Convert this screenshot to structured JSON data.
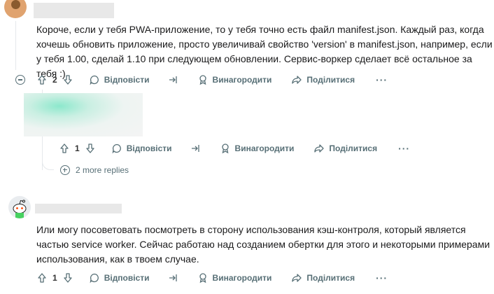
{
  "comments": [
    {
      "text": "Короче, если у тебя PWA-приложение, то у тебя точно есть файл manifest.json. Каждый раз, когда хочешь обновить приложение, просто увеличивай свойство 'version' в manifest.json, например, если у тебя 1.00, сделай 1.10 при следующем обновлении. Сервис-воркер сделает всё остальное за тебя :)",
      "votes": "2"
    },
    {
      "text": "",
      "votes": "1",
      "more_replies": "2 more replies"
    },
    {
      "text": "Или могу посоветовать посмотреть в сторону использования кэш-контроля, который является частью service worker. Сейчас работаю над созданием обертки для этого и некоторыми примерами использования, как в твоем случае.",
      "votes": "1"
    }
  ],
  "actions": {
    "reply": "Відповісти",
    "award": "Винагородити",
    "share": "Поділитися",
    "more": "···"
  },
  "icons": [
    "upvote-icon",
    "downvote-icon",
    "comment-icon",
    "swap-icon",
    "award-icon",
    "share-icon",
    "more-icon",
    "collapse-icon",
    "expand-icon"
  ]
}
